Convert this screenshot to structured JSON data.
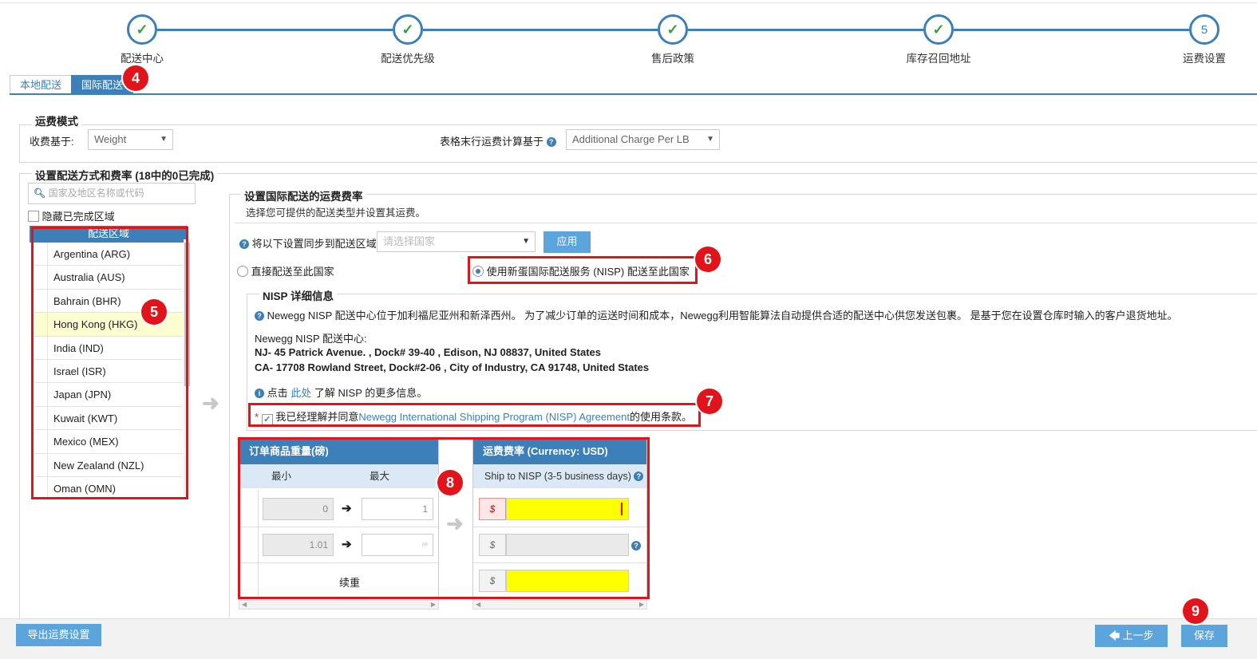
{
  "stepper": {
    "steps": [
      {
        "label": "配送中心",
        "state": "done",
        "mark": "✓"
      },
      {
        "label": "配送优先级",
        "state": "done",
        "mark": "✓"
      },
      {
        "label": "售后政策",
        "state": "done",
        "mark": "✓"
      },
      {
        "label": "库存召回地址",
        "state": "done",
        "mark": "✓"
      },
      {
        "label": "运费设置",
        "state": "current",
        "mark": "5"
      }
    ]
  },
  "tabs": [
    {
      "label": "本地配送",
      "active": false
    },
    {
      "label": "国际配送",
      "active": true
    }
  ],
  "annotations": {
    "b4": "4",
    "b5": "5",
    "b6": "6",
    "b7": "7",
    "b8": "8",
    "b9": "9"
  },
  "freight_mode": {
    "legend": "运费模式",
    "charge_label": "收费基于:",
    "charge_value": "Weight",
    "lastrow_label": "表格末行运费计算基于",
    "lastrow_value": "Additional Charge Per LB"
  },
  "setup": {
    "legend": "设置配送方式和费率 (18中的0已完成)",
    "search_placeholder": "国家及地区名称或代码",
    "hide_completed": "隐藏已完成区域",
    "region_header": "配送区域",
    "regions": [
      "Argentina (ARG)",
      "Australia (AUS)",
      "Bahrain (BHR)",
      "Hong Kong (HKG)",
      "India (IND)",
      "Israel (ISR)",
      "Japan (JPN)",
      "Kuwait (KWT)",
      "Mexico (MEX)",
      "New Zealand (NZL)",
      "Oman (OMN)"
    ],
    "highlighted_region": 3
  },
  "intl": {
    "legend": "设置国际配送的运费费率",
    "subtitle": "选择您可提供的配送类型并设置其运费。",
    "sync_label": "将以下设置同步到配送区域:",
    "sync_placeholder": "请选择国家",
    "apply": "应用",
    "radio_direct": "直接配送至此国家",
    "radio_nisp": "使用新蛋国际配送服务 (NISP) 配送至此国家"
  },
  "nisp": {
    "legend": "NISP 详细信息",
    "desc": "Newegg NISP 配送中心位于加利福尼亚州和新泽西州。 为了减少订单的运送时间和成本，Newegg利用智能算法自动提供合适的配送中心供您发送包裹。 是基于您在设置仓库时输入的客户退货地址。",
    "centers_title": "Newegg NISP 配送中心:",
    "addr_nj": "NJ- 45 Patrick Avenue. , Dock# 39-40 , Edison, NJ 08837, United States",
    "addr_ca": "CA- 17708 Rowland Street, Dock#2-06 , City of Industry, CA 91748, United States",
    "more_prefix": "点击",
    "more_link": "此处",
    "more_suffix": "了解 NISP 的更多信息。",
    "agree_star": "*",
    "agree_prefix": "我已经理解并同意",
    "agree_link": "Newegg International Shipping Program (NISP) Agreement",
    "agree_suffix": "的使用条款。"
  },
  "weight_table": {
    "title": "订单商品重量(磅)",
    "col_min": "最小",
    "col_max": "最大",
    "rows": [
      {
        "min": "0",
        "max": "1"
      },
      {
        "min": "1.01",
        "max": "∞"
      }
    ],
    "extra_label": "续重"
  },
  "rate_table": {
    "title": "运费费率 (Currency: USD)",
    "col": "Ship to NISP (3-5 business days)",
    "currency_symbol": "$"
  },
  "footer": {
    "export": "导出运费设置",
    "prev": "上一步",
    "save": "保存"
  },
  "colors": {
    "primary": "#3d7fb8",
    "accent_button": "#5ba4dc",
    "annotation_red": "#e1141b",
    "highlight_yellow": "#ffff00"
  }
}
